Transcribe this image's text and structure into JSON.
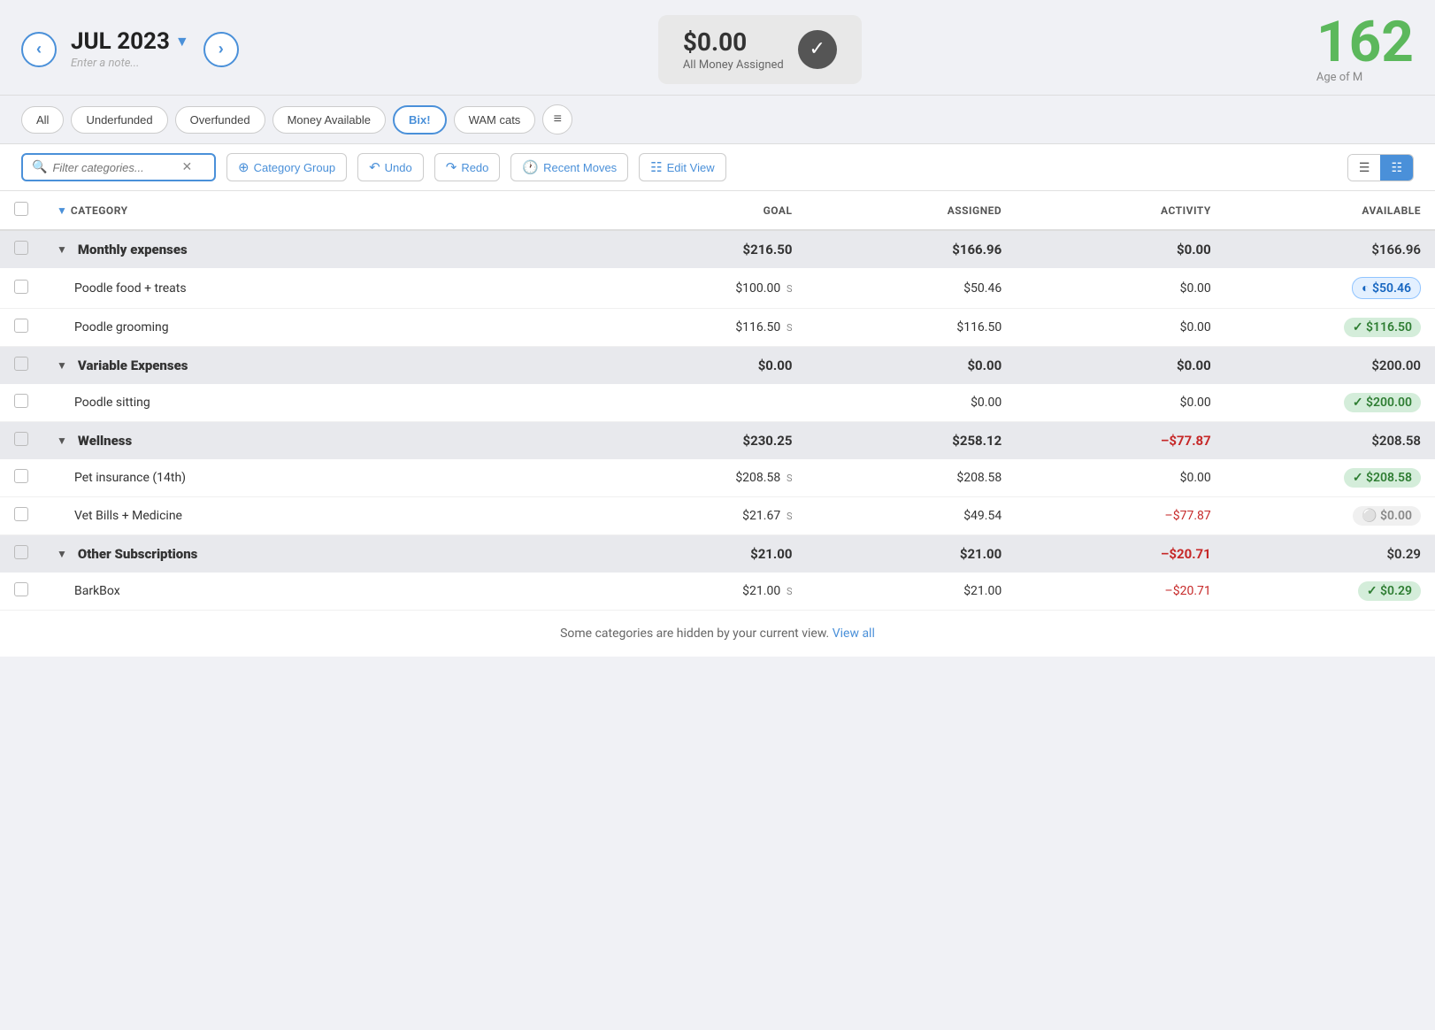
{
  "header": {
    "month": "JUL 2023",
    "note_placeholder": "Enter a note...",
    "assigned_amount": "$0.00",
    "assigned_label": "All Money Assigned",
    "age_number": "162",
    "age_label": "Age of M"
  },
  "filter_buttons": [
    {
      "label": "All",
      "active": false
    },
    {
      "label": "Underfunded",
      "active": false
    },
    {
      "label": "Overfunded",
      "active": false
    },
    {
      "label": "Money Available",
      "active": false
    },
    {
      "label": "Bix!",
      "active": true
    },
    {
      "label": "WAM cats",
      "active": false
    }
  ],
  "toolbar": {
    "search_placeholder": "Filter categories...",
    "category_group_label": "Category Group",
    "undo_label": "Undo",
    "redo_label": "Redo",
    "recent_moves_label": "Recent Moves",
    "edit_view_label": "Edit View"
  },
  "table": {
    "headers": {
      "category": "CATEGORY",
      "goal": "GOAL",
      "assigned": "ASSIGNED",
      "activity": "ACTIVITY",
      "available": "AVAILABLE"
    },
    "groups": [
      {
        "name": "Monthly expenses",
        "goal": "$216.50",
        "assigned": "$166.96",
        "activity": "$0.00",
        "available": "$166.96",
        "available_style": "plain",
        "categories": [
          {
            "name": "Poodle food + treats",
            "goal": "$100.00",
            "goal_s": true,
            "assigned": "$50.46",
            "activity": "$0.00",
            "available": "$50.46",
            "available_style": "blue"
          },
          {
            "name": "Poodle grooming",
            "goal": "$116.50",
            "goal_s": true,
            "assigned": "$116.50",
            "activity": "$0.00",
            "available": "$116.50",
            "available_style": "green"
          }
        ]
      },
      {
        "name": "Variable Expenses",
        "goal": "$0.00",
        "assigned": "$0.00",
        "activity": "$0.00",
        "available": "$200.00",
        "available_style": "plain",
        "categories": [
          {
            "name": "Poodle sitting",
            "goal": "",
            "goal_s": false,
            "assigned": "$0.00",
            "activity": "$0.00",
            "available": "$200.00",
            "available_style": "green"
          }
        ]
      },
      {
        "name": "Wellness",
        "goal": "$230.25",
        "assigned": "$258.12",
        "activity": "–$77.87",
        "available": "$208.58",
        "available_style": "plain",
        "categories": [
          {
            "name": "Pet insurance (14th)",
            "goal": "$208.58",
            "goal_s": true,
            "assigned": "$208.58",
            "activity": "$0.00",
            "available": "$208.58",
            "available_style": "green"
          },
          {
            "name": "Vet Bills + Medicine",
            "goal": "$21.67",
            "goal_s": true,
            "assigned": "$49.54",
            "activity": "–$77.87",
            "available": "$0.00",
            "available_style": "gray"
          }
        ]
      },
      {
        "name": "Other Subscriptions",
        "goal": "$21.00",
        "assigned": "$21.00",
        "activity": "–$20.71",
        "available": "$0.29",
        "available_style": "plain",
        "categories": [
          {
            "name": "BarkBox",
            "goal": "$21.00",
            "goal_s": true,
            "assigned": "$21.00",
            "activity": "–$20.71",
            "available": "$0.29",
            "available_style": "green"
          }
        ]
      }
    ]
  },
  "footer": {
    "text": "Some categories are hidden by your current view.",
    "link_text": "View all"
  }
}
